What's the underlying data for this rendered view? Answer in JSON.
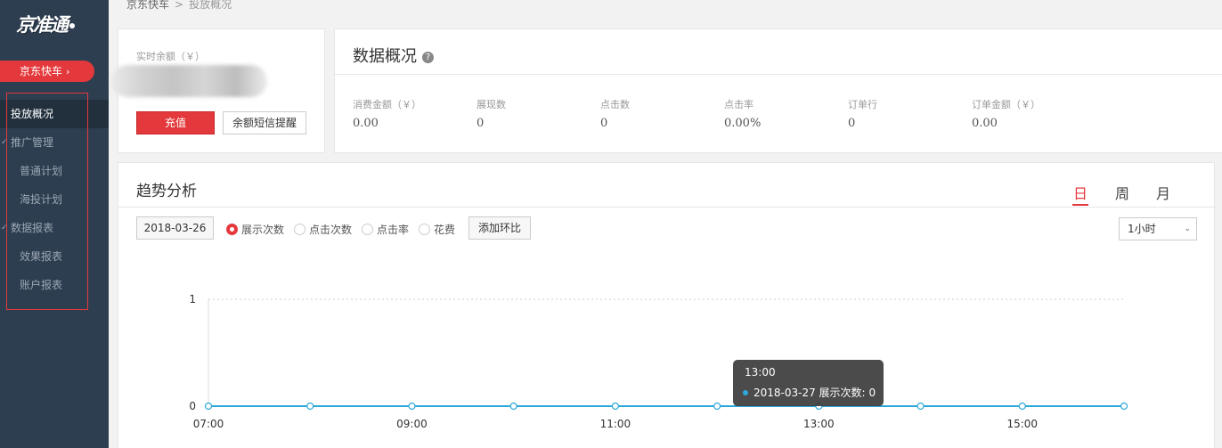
{
  "logo": {
    "text": "京准通"
  },
  "sidebar": {
    "product_label": "京东快车",
    "items": [
      {
        "label": "投放概况"
      },
      {
        "label": "推广管理"
      },
      {
        "label": "普通计划"
      },
      {
        "label": "海投计划"
      },
      {
        "label": "数据报表"
      },
      {
        "label": "效果报表"
      },
      {
        "label": "账户报表"
      }
    ]
  },
  "breadcrumb": {
    "root": "京东快车",
    "current": "投放概况"
  },
  "balance": {
    "label": "实时余额（￥）",
    "recharge_label": "充值",
    "sms_label": "余额短信提醒"
  },
  "overview": {
    "title": "数据概况",
    "metrics": [
      {
        "label": "消费金额（￥）",
        "value": "0.00"
      },
      {
        "label": "展现数",
        "value": "0"
      },
      {
        "label": "点击数",
        "value": "0"
      },
      {
        "label": "点击率",
        "value": "0.00%"
      },
      {
        "label": "订单行",
        "value": "0"
      },
      {
        "label": "订单金额（￥）",
        "value": "0.00"
      }
    ]
  },
  "trend": {
    "title": "趋势分析",
    "tabs": [
      {
        "label": "日",
        "active": true
      },
      {
        "label": "周"
      },
      {
        "label": "月"
      }
    ],
    "date": "2018-03-26",
    "radios": [
      {
        "label": "展示次数",
        "checked": true
      },
      {
        "label": "点击次数"
      },
      {
        "label": "点击率"
      },
      {
        "label": "花费"
      }
    ],
    "compare_label": "添加环比",
    "interval": "1小时",
    "tooltip": {
      "title": "13:00",
      "series": "2018-03-27 展示次数:",
      "value": "0"
    }
  },
  "colors": {
    "accent": "#e4393c",
    "sidebar_bg": "#2d3e50",
    "series": "#2da9d9"
  },
  "chart_data": {
    "type": "line",
    "x": [
      "07:00",
      "08:00",
      "09:00",
      "10:00",
      "11:00",
      "12:00",
      "13:00",
      "14:00",
      "15:00",
      "16:00"
    ],
    "xticks": [
      "07:00",
      "09:00",
      "11:00",
      "13:00",
      "15:00"
    ],
    "series": [
      {
        "name": "展示次数",
        "values": [
          0,
          0,
          0,
          0,
          0,
          0,
          0,
          0,
          0,
          0
        ]
      }
    ],
    "ylim": [
      0,
      1
    ],
    "yticks": [
      0,
      1
    ],
    "grid": true
  }
}
